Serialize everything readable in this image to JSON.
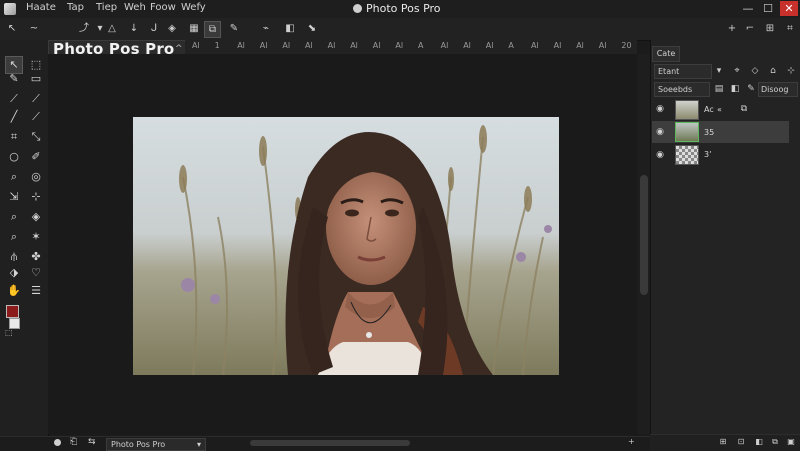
{
  "titlebar": {
    "menus": [
      "Haate",
      "Tap",
      "Tiep",
      "Weh",
      "Foow",
      "Wefy"
    ],
    "title": "Photo Pos Pro",
    "minimize": "—",
    "maximize": "☐",
    "close": "✕"
  },
  "options_bar": {
    "icons": [
      "pointer-icon",
      "wave-icon",
      "transform-icon",
      "triangle-icon",
      "arrow-down-icon",
      "curve-icon",
      "mask-icon",
      "select-icon",
      "brush-icon",
      "wand-icon"
    ],
    "right_icons": [
      "plus-icon",
      "fit-icon",
      "grid-icon"
    ]
  },
  "document": {
    "tab_title": "Photo Pos Pro",
    "tab_close": "^",
    "ruler_labels": [
      "Al",
      "1",
      "Al",
      "Al",
      "Al",
      "Al",
      "Al",
      "Al",
      "Al",
      "Al",
      "A",
      "Al",
      "Al",
      "Al",
      "A",
      "Al",
      "Al",
      "Al",
      "Al",
      "20"
    ]
  },
  "status_bar": {
    "selector": "Photo Pos Pro",
    "selector_arrow": "▾"
  },
  "right_panel": {
    "tab": "Cate",
    "blend_mode": "Etant",
    "opacity_label": "Soeebds",
    "lock_label": "Disoog",
    "layers": [
      {
        "name": "Ac",
        "extra": "«",
        "kind": "photo"
      },
      {
        "name": "35",
        "extra": "",
        "kind": "photo"
      },
      {
        "name": "3ʼ",
        "extra": "",
        "kind": "transparent"
      }
    ]
  },
  "colors": {
    "foreground": "#8b1a1a",
    "background": "#e8e8e8",
    "accent_selected": "#3d3d3d"
  }
}
